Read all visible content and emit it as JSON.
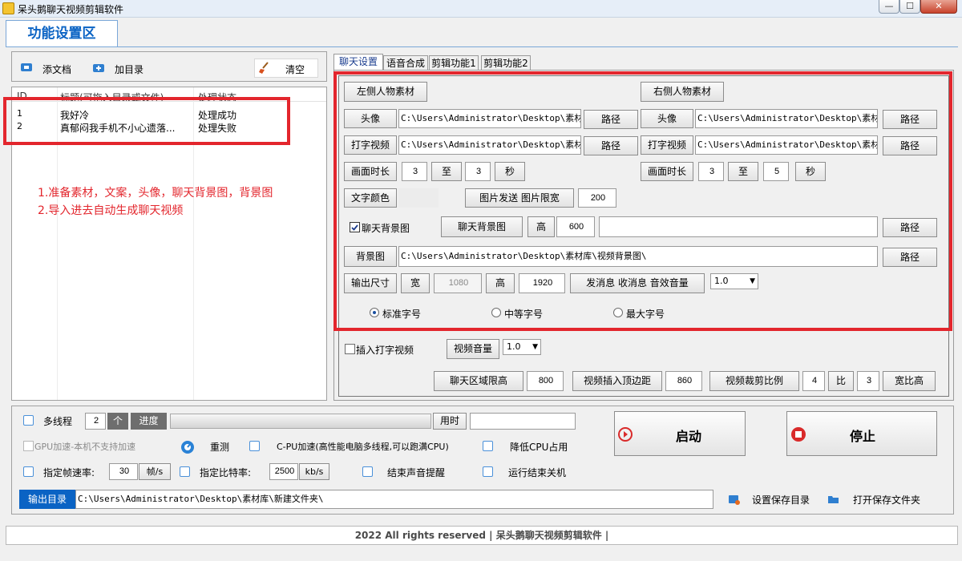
{
  "window": {
    "title": "呆头鹅聊天视频剪辑软件",
    "btn_min": "—",
    "btn_max": "☐",
    "btn_close": "✕"
  },
  "main_tab": "功能设置区",
  "toolbar": {
    "add_doc": "添文档",
    "add_dir": "加目录",
    "clear": "清空"
  },
  "file_list": {
    "columns": [
      "ID",
      "标题(可拖入目录或文件)",
      "处理状态"
    ],
    "rows": [
      {
        "id": "1",
        "title": "我好冷",
        "status": "处理成功"
      },
      {
        "id": "2",
        "title": "真郁闷我手机不小心遗落...",
        "status": "处理失败"
      }
    ]
  },
  "notes": {
    "line1": "1.准备素材，文案，头像，聊天背景图，背景图",
    "line2": "2.导入进去自动生成聊天视频"
  },
  "tabs": [
    "聊天设置",
    "语音合成",
    "剪辑功能1",
    "剪辑功能2"
  ],
  "chat": {
    "left_material": "左侧人物素材",
    "right_material": "右侧人物素材",
    "avatar": "头像",
    "typing_video": "打字视频",
    "path": "路径",
    "left_avatar_path": "C:\\Users\\Administrator\\Desktop\\素材库\\",
    "left_typing_path": "C:\\Users\\Administrator\\Desktop\\素材库\\",
    "right_avatar_path": "C:\\Users\\Administrator\\Desktop\\素材库\\",
    "right_typing_path": "C:\\Users\\Administrator\\Desktop\\素材库\\",
    "duration": "画面时长",
    "to": "至",
    "sec": "秒",
    "left_dur_from": "3",
    "left_dur_to": "3",
    "right_dur_from": "3",
    "right_dur_to": "5",
    "text_color": "文字颜色",
    "img_send": "图片发送 图片限宽",
    "img_width": "200",
    "chat_bg_check": "聊天背景图",
    "chat_bg_btn": "聊天背景图",
    "high": "高",
    "chat_bg_height": "600",
    "chat_bg_path": "",
    "bg_btn": "背景图",
    "bg_path": "C:\\Users\\Administrator\\Desktop\\素材库\\视频背景图\\",
    "output_size": "输出尺寸",
    "wide": "宽",
    "out_width": "1080",
    "out_height": "1920",
    "send_recv": "发消息 收消息 音效音量",
    "volume": "1.0",
    "font_std": "标准字号",
    "font_mid": "中等字号",
    "font_max": "最大字号",
    "insert_typing": "插入打字视频",
    "video_volume": "视频音量",
    "video_volume_value": "1.0",
    "chat_area_height": "聊天区域限高",
    "chat_area_value": "800",
    "video_insert_top": "视频插入顶边距",
    "video_insert_value": "860",
    "crop_ratio": "视频裁剪比例",
    "ratio_a": "4",
    "ratio_word": "比",
    "ratio_b": "3",
    "wide_high": "宽比高"
  },
  "bottom": {
    "multithread": "多线程",
    "threads": "2",
    "unit_ge": "个",
    "progress": "进度",
    "time_used": "用时",
    "time_value": "",
    "gpu": "GPU加速-本机不支持加速",
    "retest": "重测",
    "cpu_accel": "C-PU加速(高性能电脑多线程,可以跑满CPU)",
    "lower_cpu": "降低CPU占用",
    "fps_label": "指定帧速率:",
    "fps": "30",
    "fps_unit": "帧/s",
    "bitrate_label": "指定比特率:",
    "bitrate": "2500",
    "bitrate_unit": "kb/s",
    "end_sound": "结束声音提醒",
    "shutdown": "运行结束关机",
    "start": "启动",
    "stop": "停止",
    "output_dir_label": "输出目录",
    "output_dir": "C:\\Users\\Administrator\\Desktop\\素材库\\新建文件夹\\",
    "set_save_dir": "设置保存目录",
    "open_save_dir": "打开保存文件夹"
  },
  "footer": "2022 All rights reserved | 呆头鹅聊天视频剪辑软件 |",
  "colors": {
    "accent": "#0a63c4",
    "highlight": "#e3262d",
    "note": "#e3262d"
  }
}
